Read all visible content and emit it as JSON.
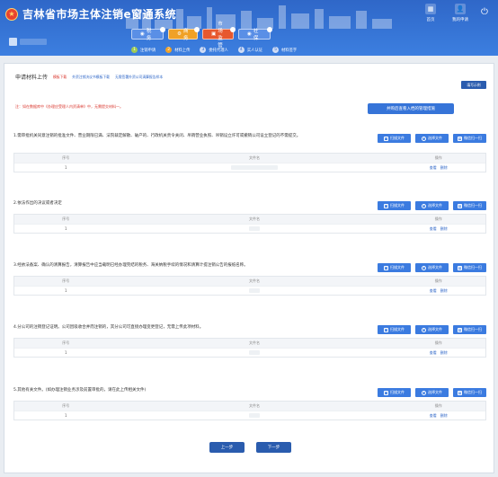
{
  "header": {
    "app_title": "吉林省市场主体注销e窗通系统",
    "home_label": "首页",
    "apply_label": "我的申请",
    "category_tabs": [
      {
        "label": "税务",
        "color": "#5a8fe6"
      },
      {
        "label": "商务",
        "color": "#f0a126"
      },
      {
        "label": "市场监管",
        "color": "#e7582e"
      },
      {
        "label": "社保",
        "color": "#5a8fe6"
      }
    ],
    "steps": [
      {
        "num": "1",
        "label": "注销申请",
        "state": "done"
      },
      {
        "num": "2",
        "label": "材料上传",
        "state": "current"
      },
      {
        "num": "3",
        "label": "委托代理人",
        "state": "todo"
      },
      {
        "num": "4",
        "label": "实人认证",
        "state": "todo"
      },
      {
        "num": "5",
        "label": "材料签字",
        "state": "todo"
      }
    ]
  },
  "section": {
    "title": "申请材料上传",
    "template_link": "模板下载",
    "link_foreign": "外资注销决议书模板下载",
    "link_guide": "无需签署外资公司清算报告样本",
    "fill_guide": "填写示例",
    "note": "注：如在数据库中《办理应受理人内资清单》中，无需提交材料一。",
    "view_merger_button": "并购后查看入档的管理措施"
  },
  "materials": [
    {
      "title": "1.需审批机关同意注销的批准文件、营业期限已满、法院裁定解散、破产的、行政机关责令关闭、吊销营业执照、吊销设立许可或撤销公司设立登记的不需提交。",
      "rows": [
        {
          "seq": "1"
        }
      ]
    },
    {
      "title": "2.依法作出的决议或者决定",
      "rows": [
        {
          "seq": "1"
        }
      ]
    },
    {
      "title": "3.经依法备案、确认的清算报告，清算报告中应当载明已经办理完结的税务、海关纳税手续的情况和清算计提注销公告的报纸名称。",
      "rows": [
        {
          "seq": "1"
        }
      ]
    },
    {
      "title": "4.分公司的注销登记证明。公司因吸收合并而注销的，其分公司可直接办理变更登记，无需上传此项材料。",
      "rows": [
        {
          "seq": "1"
        }
      ]
    },
    {
      "title": "5.其他有关文件。(如办理注销业务涉及前置审批的，请在此上传相关文件)",
      "rows": [
        {
          "seq": "1"
        }
      ]
    }
  ],
  "material_buttons": {
    "scan": "扫描文件",
    "choose": "选择文件",
    "batch": "微信扫一扫"
  },
  "table_headers": {
    "seq": "序号",
    "file": "文件名",
    "op": "操作"
  },
  "row_ops": {
    "view": "查看",
    "delete": "删除"
  },
  "nav": {
    "prev": "上一步",
    "next": "下一步"
  }
}
